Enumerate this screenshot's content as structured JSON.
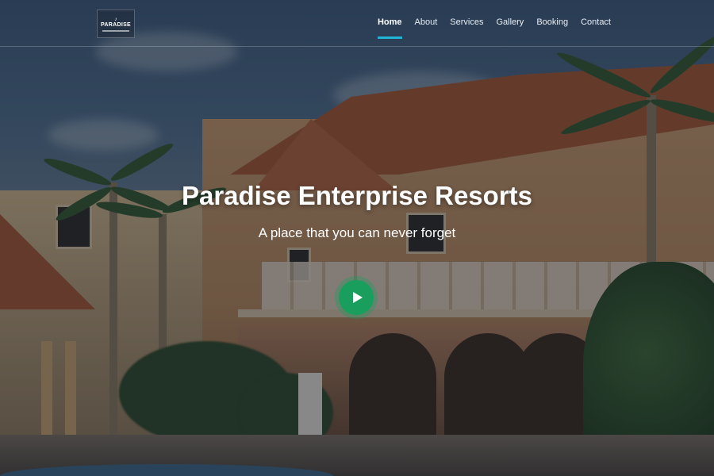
{
  "brand": {
    "logo_mark": "♪",
    "logo_text": "PARADISE"
  },
  "nav": {
    "items": [
      {
        "label": "Home",
        "active": true
      },
      {
        "label": "About",
        "active": false
      },
      {
        "label": "Services",
        "active": false
      },
      {
        "label": "Gallery",
        "active": false
      },
      {
        "label": "Booking",
        "active": false
      },
      {
        "label": "Contact",
        "active": false
      }
    ]
  },
  "hero": {
    "title": "Paradise Enterprise Resorts",
    "subtitle": "A place that you can never forget",
    "play_icon": "play-icon"
  },
  "colors": {
    "accent": "#22b3d4",
    "play_button": "#1a9e5e",
    "text": "#ffffff"
  }
}
